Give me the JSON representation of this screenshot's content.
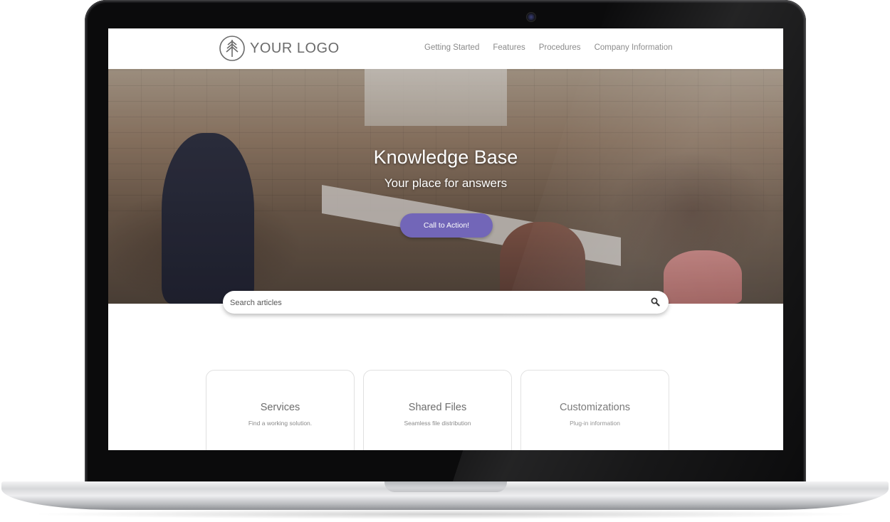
{
  "header": {
    "logo_text": "YOUR LOGO",
    "nav": [
      "Getting Started",
      "Features",
      "Procedures",
      "Company Information"
    ]
  },
  "hero": {
    "title": "Knowledge Base",
    "subtitle": "Your place for answers",
    "cta_label": "Call to Action!"
  },
  "search": {
    "placeholder": "Search articles"
  },
  "cards": [
    {
      "title": "Services",
      "subtitle": "Find a working solution."
    },
    {
      "title": "Shared Files",
      "subtitle": "Seamless file distribution"
    },
    {
      "title": "Customizations",
      "subtitle": "Plug-in information"
    }
  ],
  "colors": {
    "accent": "#7266b8",
    "text_muted": "#8a8a8a"
  },
  "icons": [
    "tree-logo-icon",
    "search-icon",
    "camera-icon"
  ]
}
